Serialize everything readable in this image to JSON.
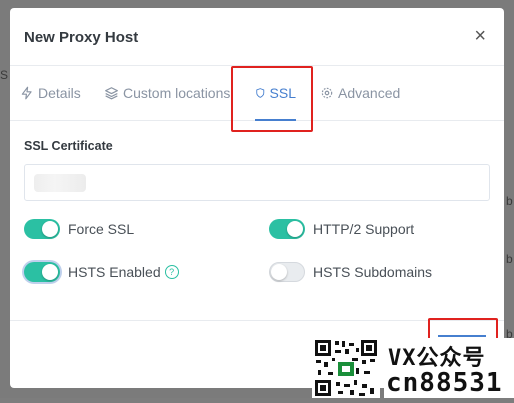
{
  "background": {
    "left_fragment": "S",
    "right_fragments": [
      "b",
      "b",
      "b"
    ]
  },
  "modal": {
    "title": "New Proxy Host",
    "close_symbol": "×"
  },
  "tabs": [
    {
      "label": "Details",
      "icon": "zap-icon",
      "active": false
    },
    {
      "label": "Custom locations",
      "icon": "layers-icon",
      "active": false
    },
    {
      "label": "SSL",
      "icon": "shield-icon",
      "active": true
    },
    {
      "label": "Advanced",
      "icon": "gear-icon",
      "active": false
    }
  ],
  "ssl": {
    "section_label": "SSL Certificate",
    "certificate_value": ""
  },
  "toggles": {
    "force_ssl": {
      "label": "Force SSL",
      "on": true
    },
    "http2": {
      "label": "HTTP/2 Support",
      "on": true
    },
    "hsts": {
      "label": "HSTS Enabled",
      "on": true,
      "help": "?"
    },
    "hsts_subdomains": {
      "label": "HSTS Subdomains",
      "on": false
    }
  },
  "watermark": {
    "line1": "VX公众号",
    "line2": "cn88531"
  },
  "colors": {
    "accent": "#467fcf",
    "toggle_on": "#2bc0a3",
    "highlight": "#e0221f"
  }
}
